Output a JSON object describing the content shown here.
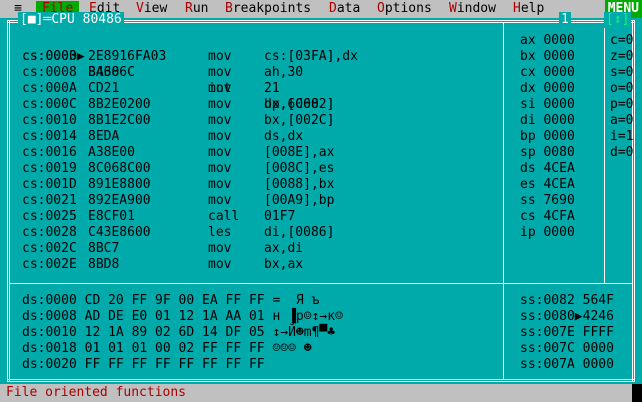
{
  "menubar": {
    "system": "≡",
    "items": [
      {
        "hot": "F",
        "rest": "ile"
      },
      {
        "hot": "E",
        "rest": "dit"
      },
      {
        "hot": "V",
        "rest": "iew"
      },
      {
        "hot": "R",
        "rest": "un"
      },
      {
        "hot": "B",
        "rest": "reakpoints"
      },
      {
        "hot": "D",
        "rest": "ata"
      },
      {
        "hot": "O",
        "rest": "ptions"
      },
      {
        "hot": "W",
        "rest": "indow"
      },
      {
        "hot": "H",
        "rest": "elp"
      }
    ],
    "badge": "MENU"
  },
  "window": {
    "close_box": "[■]",
    "title": "CPU 80486",
    "number": "1",
    "zoom_box": "[↕]"
  },
  "code": [
    {
      "addr": "cs:0000",
      "marker": "▶",
      "bytes": "BA686C",
      "mnemonic": "mov",
      "operands": "dx,6C68"
    },
    {
      "addr": "cs:0003",
      "marker": " ",
      "bytes": "2E8916FA03",
      "mnemonic": "mov",
      "operands": "cs:[03FA],dx"
    },
    {
      "addr": "cs:0008",
      "marker": " ",
      "bytes": "B430",
      "mnemonic": "mov",
      "operands": "ah,30"
    },
    {
      "addr": "cs:000A",
      "marker": " ",
      "bytes": "CD21",
      "mnemonic": "int",
      "operands": "21"
    },
    {
      "addr": "cs:000C",
      "marker": " ",
      "bytes": "8B2E0200",
      "mnemonic": "mov",
      "operands": "bp,[0002]"
    },
    {
      "addr": "cs:0010",
      "marker": " ",
      "bytes": "8B1E2C00",
      "mnemonic": "mov",
      "operands": "bx,[002C]"
    },
    {
      "addr": "cs:0014",
      "marker": " ",
      "bytes": "8EDA",
      "mnemonic": "mov",
      "operands": "ds,dx"
    },
    {
      "addr": "cs:0016",
      "marker": " ",
      "bytes": "A38E00",
      "mnemonic": "mov",
      "operands": "[008E],ax"
    },
    {
      "addr": "cs:0019",
      "marker": " ",
      "bytes": "8C068C00",
      "mnemonic": "mov",
      "operands": "[008C],es"
    },
    {
      "addr": "cs:001D",
      "marker": " ",
      "bytes": "891E8800",
      "mnemonic": "mov",
      "operands": "[0088],bx"
    },
    {
      "addr": "cs:0021",
      "marker": " ",
      "bytes": "892EA900",
      "mnemonic": "mov",
      "operands": "[00A9],bp"
    },
    {
      "addr": "cs:0025",
      "marker": " ",
      "bytes": "E8CF01",
      "mnemonic": "call",
      "operands": "01F7"
    },
    {
      "addr": "cs:0028",
      "marker": " ",
      "bytes": "C43E8600",
      "mnemonic": "les",
      "operands": "di,[0086]"
    },
    {
      "addr": "cs:002C",
      "marker": " ",
      "bytes": "8BC7",
      "mnemonic": "mov",
      "operands": "ax,di"
    },
    {
      "addr": "cs:002E",
      "marker": " ",
      "bytes": "8BD8",
      "mnemonic": "mov",
      "operands": "bx,ax"
    }
  ],
  "registers": [
    "ax 0000",
    "bx 0000",
    "cx 0000",
    "dx 0000",
    "si 0000",
    "di 0000",
    "bp 0000",
    "sp 0080",
    "ds 4CEA",
    "es 4CEA",
    "ss 7690",
    "cs 4CFA",
    "ip 0000"
  ],
  "flags": [
    "c=0",
    "z=0",
    "s=0",
    "o=0",
    "p=0",
    "a=0",
    "i=1",
    "d=0"
  ],
  "dump": [
    "ds:0000 CD 20 FF 9F 00 EA FF FF =  Я ъ",
    "ds:0008 AD DE E0 01 12 1A AA 01 н ▐p☺↕→к☺",
    "ds:0010 12 1A 89 02 6D 14 DF 05 ↕→Й☻m¶▀♣",
    "ds:0018 01 01 01 00 02 FF FF FF ☺☺☺ ☻",
    "ds:0020 FF FF FF FF FF FF FF FF"
  ],
  "stack": [
    "ss:0082 564F",
    "ss:0080▶4246",
    "ss:007E FFFF",
    "ss:007C 0000",
    "ss:007A 0000"
  ],
  "status": "File oriented functions",
  "colors": {
    "desktop": "#00aaaa",
    "menubar": "#c0c0c0",
    "menu_hot": "#aa0000",
    "menu_active_bg": "#00aa00",
    "border": "#ffffff"
  }
}
